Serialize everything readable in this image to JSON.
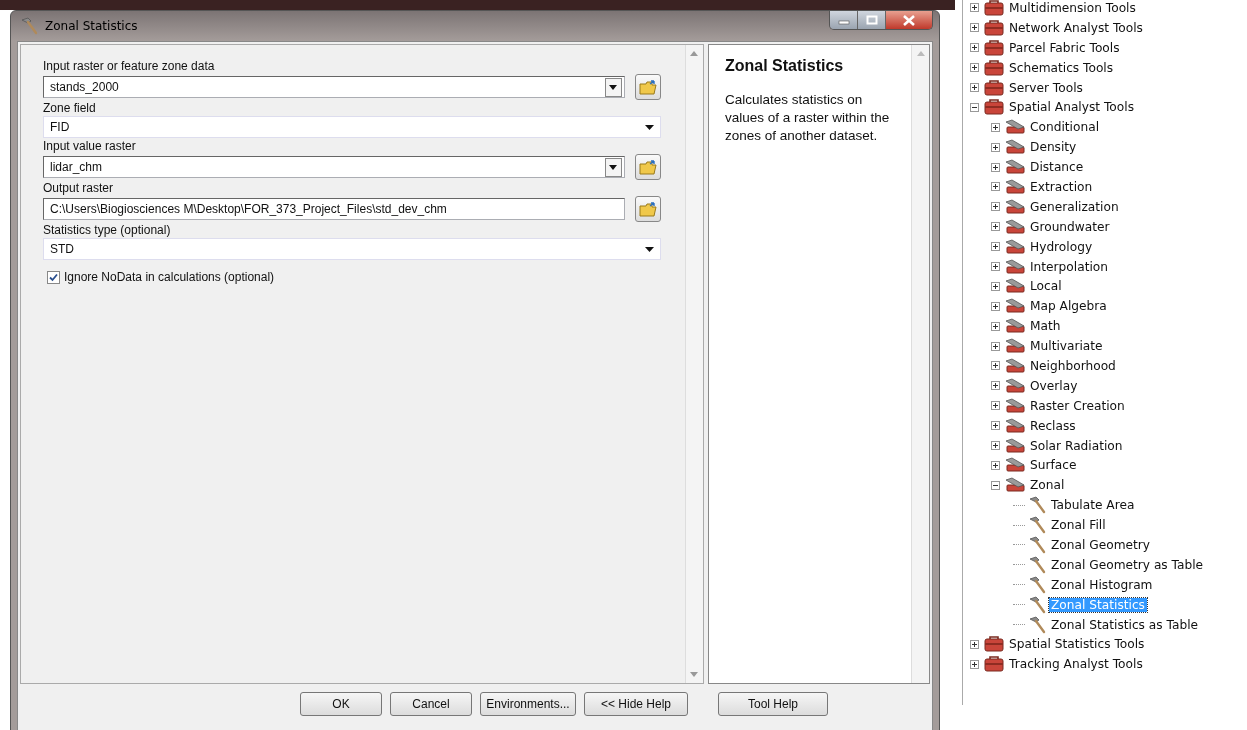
{
  "dialog": {
    "title": "Zonal Statistics",
    "parameters": [
      {
        "kind": "combo",
        "label": "Input raster or feature zone data",
        "value": "stands_2000"
      },
      {
        "kind": "dropdown",
        "label": "Zone field",
        "value": "FID"
      },
      {
        "kind": "combo",
        "label": "Input value raster",
        "value": "lidar_chm"
      },
      {
        "kind": "text",
        "label": "Output raster",
        "value": "C:\\Users\\Biogiosciences M\\Desktop\\FOR_373_Project_Files\\std_dev_chm"
      },
      {
        "kind": "dropdown",
        "label": "Statistics type (optional)",
        "value": "STD"
      },
      {
        "kind": "checkbox",
        "label": "Ignore NoData in calculations (optional)",
        "checked": true
      }
    ],
    "help": {
      "title": "Zonal Statistics",
      "text": "Calculates statistics on values of a raster within the zones of another dataset."
    },
    "buttons": [
      "OK",
      "Cancel",
      "Environments...",
      "<< Hide Help",
      "Tool Help"
    ]
  },
  "tree": [
    {
      "kind": "toolbox",
      "label": "Multidimension Tools",
      "expanded": false
    },
    {
      "kind": "toolbox",
      "label": "Network Analyst Tools",
      "expanded": false
    },
    {
      "kind": "toolbox",
      "label": "Parcel Fabric Tools",
      "expanded": false
    },
    {
      "kind": "toolbox",
      "label": "Schematics Tools",
      "expanded": false
    },
    {
      "kind": "toolbox",
      "label": "Server Tools",
      "expanded": false
    },
    {
      "kind": "toolbox",
      "label": "Spatial Analyst Tools",
      "expanded": true,
      "children": [
        {
          "kind": "toolset",
          "label": "Conditional",
          "expanded": false
        },
        {
          "kind": "toolset",
          "label": "Density",
          "expanded": false
        },
        {
          "kind": "toolset",
          "label": "Distance",
          "expanded": false
        },
        {
          "kind": "toolset",
          "label": "Extraction",
          "expanded": false
        },
        {
          "kind": "toolset",
          "label": "Generalization",
          "expanded": false
        },
        {
          "kind": "toolset",
          "label": "Groundwater",
          "expanded": false
        },
        {
          "kind": "toolset",
          "label": "Hydrology",
          "expanded": false
        },
        {
          "kind": "toolset",
          "label": "Interpolation",
          "expanded": false
        },
        {
          "kind": "toolset",
          "label": "Local",
          "expanded": false
        },
        {
          "kind": "toolset",
          "label": "Map Algebra",
          "expanded": false
        },
        {
          "kind": "toolset",
          "label": "Math",
          "expanded": false
        },
        {
          "kind": "toolset",
          "label": "Multivariate",
          "expanded": false
        },
        {
          "kind": "toolset",
          "label": "Neighborhood",
          "expanded": false
        },
        {
          "kind": "toolset",
          "label": "Overlay",
          "expanded": false
        },
        {
          "kind": "toolset",
          "label": "Raster Creation",
          "expanded": false
        },
        {
          "kind": "toolset",
          "label": "Reclass",
          "expanded": false
        },
        {
          "kind": "toolset",
          "label": "Solar Radiation",
          "expanded": false
        },
        {
          "kind": "toolset",
          "label": "Surface",
          "expanded": false
        },
        {
          "kind": "toolset",
          "label": "Zonal",
          "expanded": true,
          "children": [
            {
              "kind": "tool",
              "label": "Tabulate Area",
              "selected": false
            },
            {
              "kind": "tool",
              "label": "Zonal Fill",
              "selected": false
            },
            {
              "kind": "tool",
              "label": "Zonal Geometry",
              "selected": false
            },
            {
              "kind": "tool",
              "label": "Zonal Geometry as Table",
              "selected": false
            },
            {
              "kind": "tool",
              "label": "Zonal Histogram",
              "selected": false
            },
            {
              "kind": "tool",
              "label": "Zonal Statistics",
              "selected": true
            },
            {
              "kind": "tool",
              "label": "Zonal Statistics as Table",
              "selected": false
            }
          ]
        }
      ]
    },
    {
      "kind": "toolbox",
      "label": "Spatial Statistics Tools",
      "expanded": false
    },
    {
      "kind": "toolbox",
      "label": "Tracking Analyst Tools",
      "expanded": false
    }
  ]
}
